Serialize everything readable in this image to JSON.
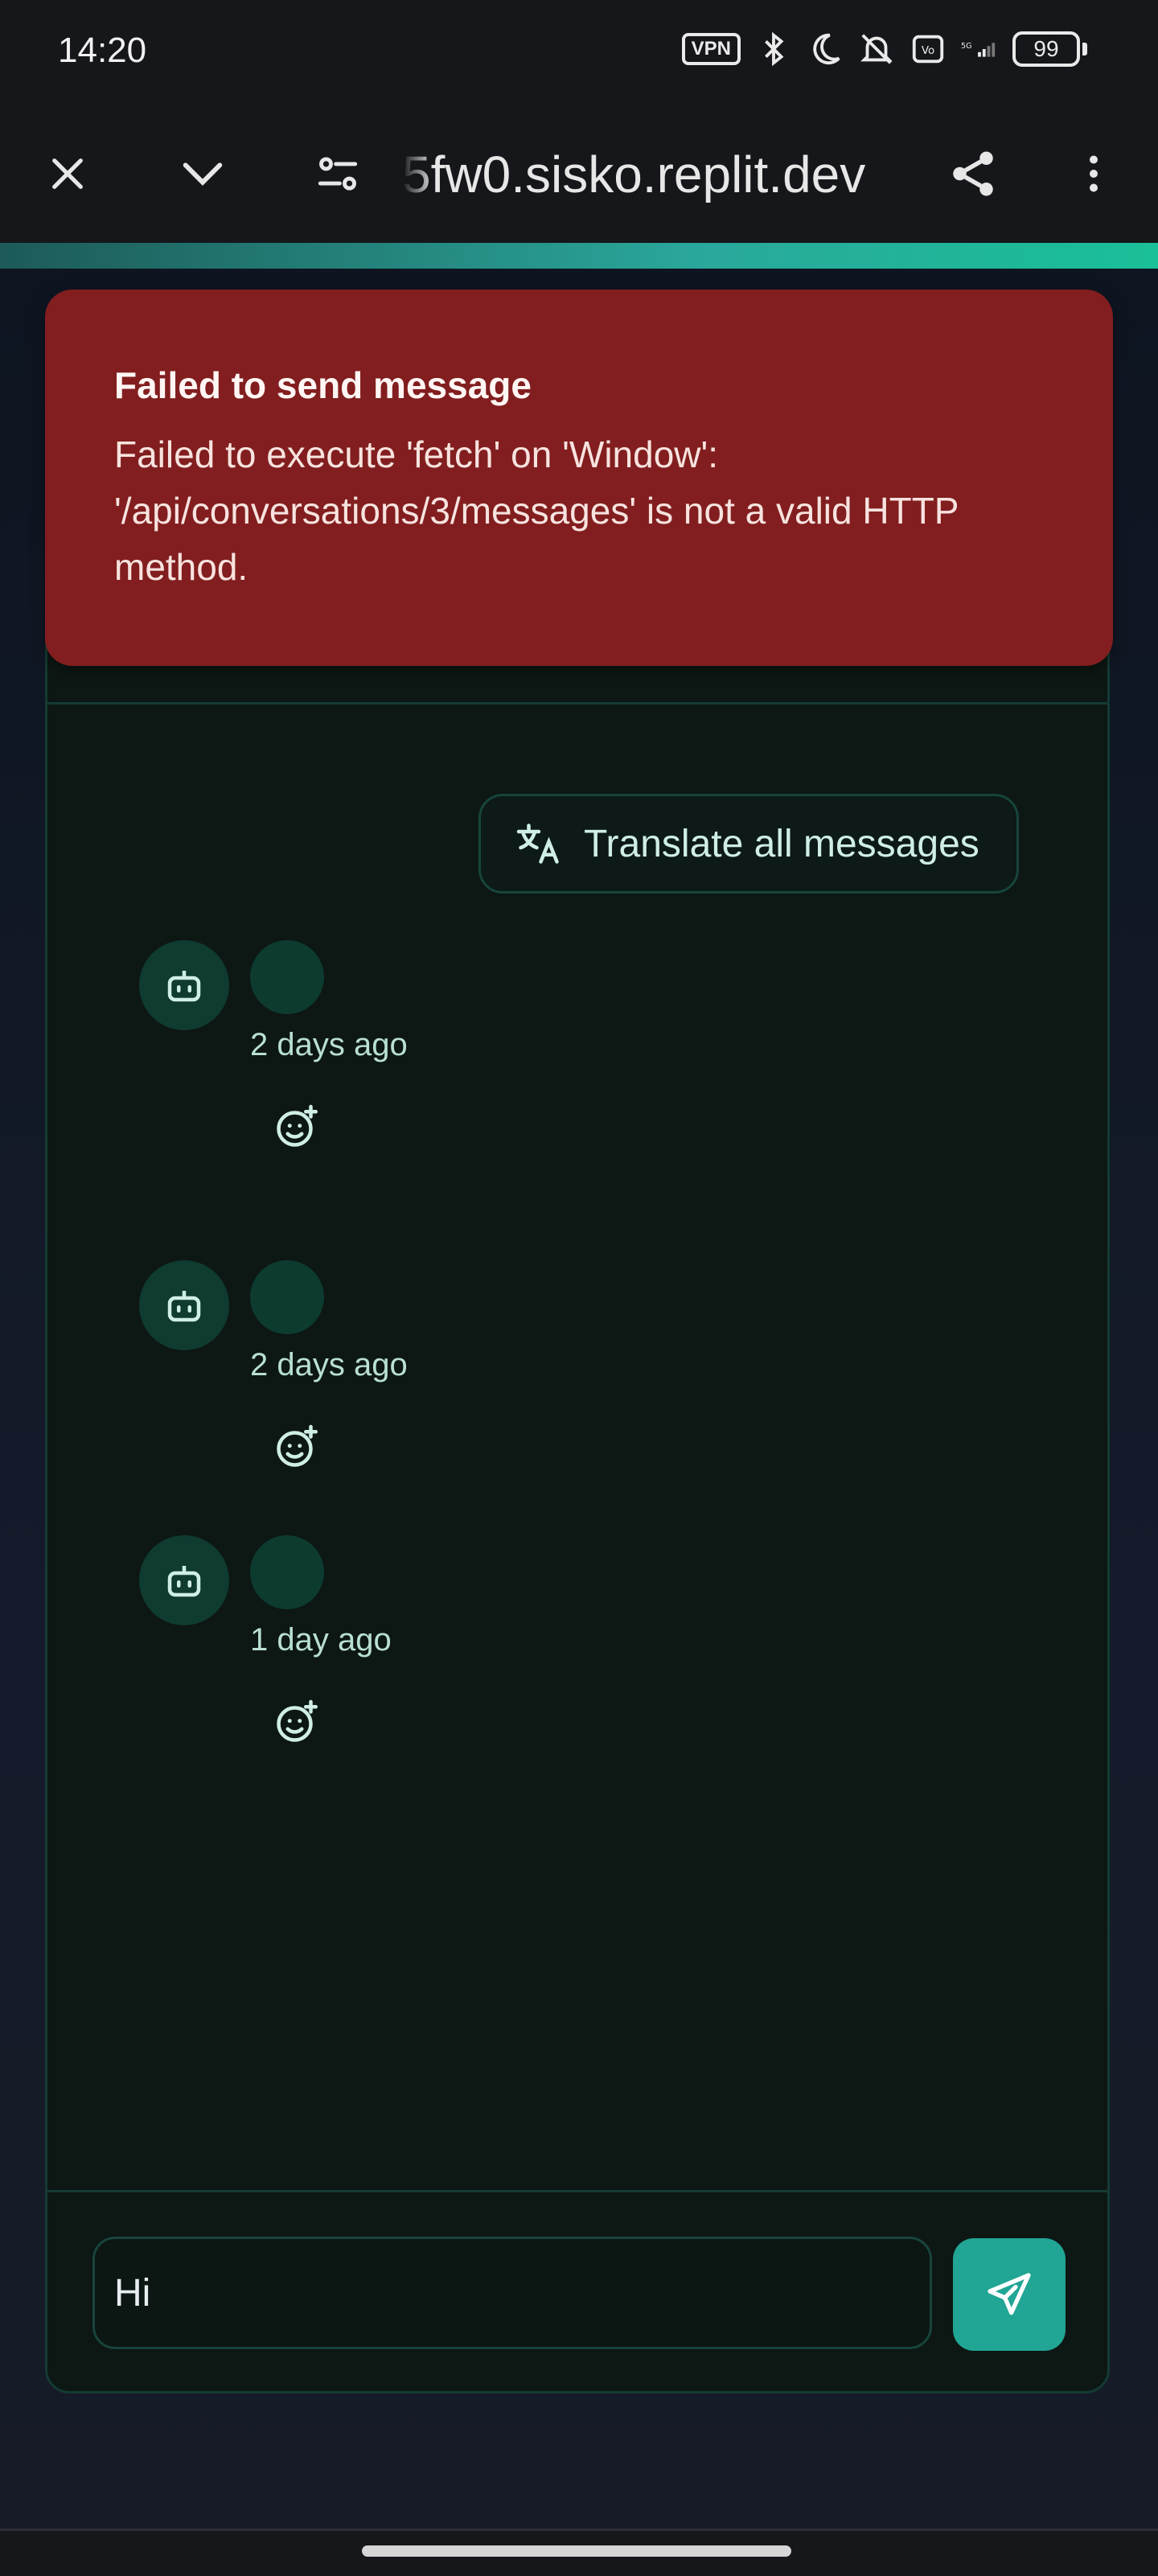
{
  "status_bar": {
    "time": "14:20",
    "vpn": "VPN",
    "battery": "99",
    "icons": [
      "vpn-icon",
      "bluetooth-icon",
      "moon-icon",
      "mute-icon",
      "volte-icon",
      "5g-signal-icon",
      "battery-icon"
    ]
  },
  "toolbar": {
    "url": "5fw0.sisko.replit.dev",
    "icons": [
      "close-icon",
      "chevron-down-icon",
      "site-settings-icon",
      "share-icon",
      "more-vert-icon"
    ]
  },
  "toast": {
    "title": "Failed to send message",
    "message": "Failed to execute 'fetch' on 'Window': '/api/conversations/3/messages' is not a valid HTTP method."
  },
  "chat": {
    "translate_label": "Translate all messages",
    "messages": [
      {
        "time": "2 days ago"
      },
      {
        "time": "2 days ago"
      },
      {
        "time": "1 day ago"
      }
    ],
    "input_value": "Hi"
  },
  "colors": {
    "accent": "#21a594",
    "error": "#821e1f",
    "panel_bg": "#0d1714",
    "panel_border": "#143b33"
  }
}
